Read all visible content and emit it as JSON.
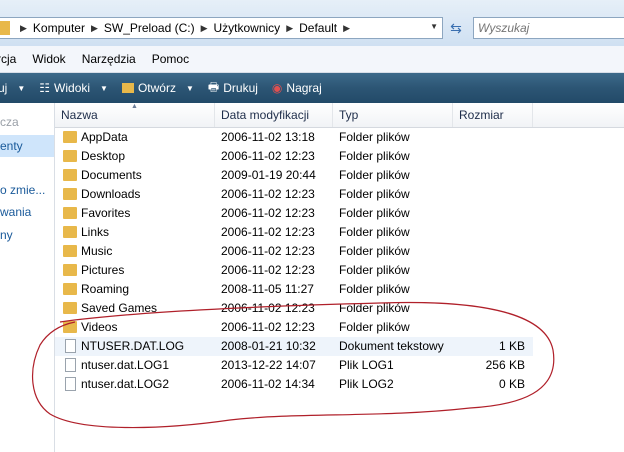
{
  "address": {
    "crumbs": [
      "Komputer",
      "SW_Preload (C:)",
      "Użytkownicy",
      "Default"
    ]
  },
  "search": {
    "placeholder": "Wyszukaj"
  },
  "menu": [
    "rcja",
    "Widok",
    "Narzędzia",
    "Pomoc"
  ],
  "toolbar": {
    "first": "uj",
    "views": "Widoki",
    "open": "Otwórz",
    "print": "Drukuj",
    "burn": "Nagraj"
  },
  "nav": {
    "a": "cza",
    "b": "enty",
    "c": "o zmie...",
    "d": "wania",
    "e": "ny"
  },
  "columns": {
    "name": "Nazwa",
    "date": "Data modyfikacji",
    "type": "Typ",
    "size": "Rozmiar"
  },
  "files": [
    {
      "name": "AppData",
      "date": "2006-11-02 13:18",
      "type": "Folder plików",
      "size": "",
      "icon": "folder"
    },
    {
      "name": "Desktop",
      "date": "2006-11-02 12:23",
      "type": "Folder plików",
      "size": "",
      "icon": "folder"
    },
    {
      "name": "Documents",
      "date": "2009-01-19 20:44",
      "type": "Folder plików",
      "size": "",
      "icon": "folder"
    },
    {
      "name": "Downloads",
      "date": "2006-11-02 12:23",
      "type": "Folder plików",
      "size": "",
      "icon": "folder"
    },
    {
      "name": "Favorites",
      "date": "2006-11-02 12:23",
      "type": "Folder plików",
      "size": "",
      "icon": "folder"
    },
    {
      "name": "Links",
      "date": "2006-11-02 12:23",
      "type": "Folder plików",
      "size": "",
      "icon": "folder"
    },
    {
      "name": "Music",
      "date": "2006-11-02 12:23",
      "type": "Folder plików",
      "size": "",
      "icon": "folder"
    },
    {
      "name": "Pictures",
      "date": "2006-11-02 12:23",
      "type": "Folder plików",
      "size": "",
      "icon": "folder"
    },
    {
      "name": "Roaming",
      "date": "2008-11-05 11:27",
      "type": "Folder plików",
      "size": "",
      "icon": "folder"
    },
    {
      "name": "Saved Games",
      "date": "2006-11-02 12:23",
      "type": "Folder plików",
      "size": "",
      "icon": "folder"
    },
    {
      "name": "Videos",
      "date": "2006-11-02 12:23",
      "type": "Folder plików",
      "size": "",
      "icon": "folder"
    },
    {
      "name": "NTUSER.DAT.LOG",
      "date": "2008-01-21 10:32",
      "type": "Dokument tekstowy",
      "size": "1 KB",
      "icon": "text-file"
    },
    {
      "name": "ntuser.dat.LOG1",
      "date": "2013-12-22 14:07",
      "type": "Plik LOG1",
      "size": "256 KB",
      "icon": "file"
    },
    {
      "name": "ntuser.dat.LOG2",
      "date": "2006-11-02 14:34",
      "type": "Plik LOG2",
      "size": "0 KB",
      "icon": "file"
    }
  ],
  "colors": {
    "toolbar": "#2c5574",
    "annotation": "#b0202a",
    "folder": "#e8b84a",
    "link": "#1a5a9a"
  }
}
